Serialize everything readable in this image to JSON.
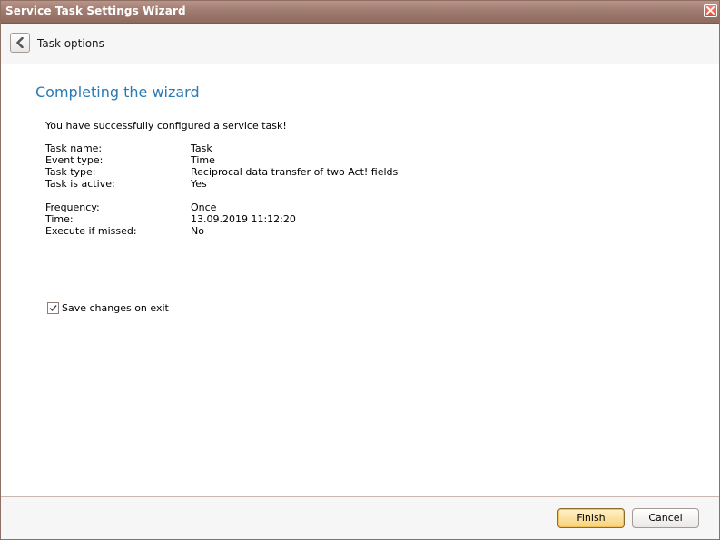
{
  "window": {
    "title": "Service Task Settings Wizard"
  },
  "nav": {
    "title": "Task options"
  },
  "content": {
    "heading": "Completing the wizard",
    "intro": "You have successfully configured a service task!",
    "summary_group1": [
      {
        "label": "Task name:",
        "value": "Task"
      },
      {
        "label": "Event type:",
        "value": "Time"
      },
      {
        "label": "Task type:",
        "value": "Reciprocal data transfer of two Act! fields"
      },
      {
        "label": "Task is active:",
        "value": "Yes"
      }
    ],
    "summary_group2": [
      {
        "label": "Frequency:",
        "value": "Once"
      },
      {
        "label": "Time:",
        "value": "13.09.2019 11:12:20"
      },
      {
        "label": "Execute if missed:",
        "value": "No"
      }
    ],
    "save_changes": {
      "label": "Save changes on exit",
      "checked": true
    }
  },
  "footer": {
    "finish_label": "Finish",
    "cancel_label": "Cancel"
  },
  "colors": {
    "titlebar": "#a07b70",
    "heading": "#2a7ab4",
    "finish_button": "#f7d27a"
  },
  "icons": {
    "close": "close-icon",
    "back": "chevron-left-icon",
    "check": "checkmark-icon"
  }
}
